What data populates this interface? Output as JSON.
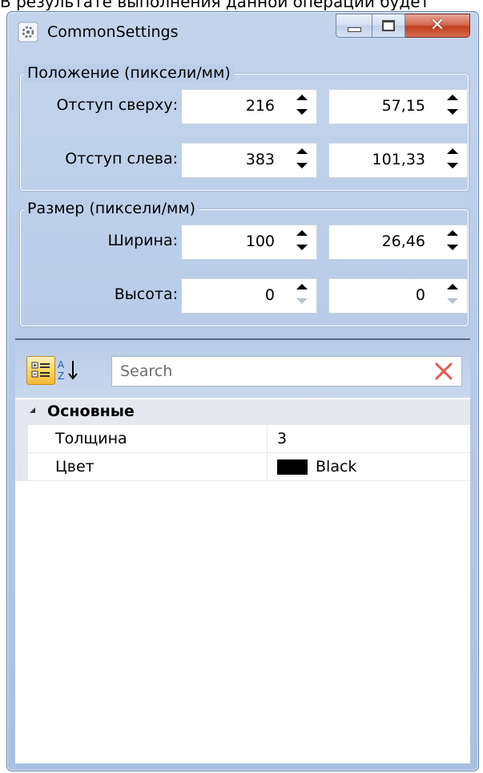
{
  "document_text": "В результате выполнения данной операции будет",
  "window": {
    "title": "CommonSettings",
    "close_glyph": "✕"
  },
  "position_group": {
    "title": "Положение (пиксели/мм)",
    "rows": [
      {
        "label": "Отступ сверху:",
        "pixels": "216",
        "mm": "57,15"
      },
      {
        "label": "Отступ слева:",
        "pixels": "383",
        "mm": "101,33"
      }
    ]
  },
  "size_group": {
    "title": "Размер (пиксели/мм)",
    "rows": [
      {
        "label": "Ширина:",
        "pixels": "100",
        "mm": "26,46"
      },
      {
        "label": "Высота:",
        "pixels": "0",
        "mm": "0"
      }
    ]
  },
  "property_grid": {
    "search": {
      "placeholder": "Search",
      "value": ""
    },
    "alpha_glyph": "↓",
    "category": "Основные",
    "properties": [
      {
        "name": "Толщина",
        "value": "3"
      },
      {
        "name": "Цвет",
        "value": "Black",
        "color": "#000000"
      }
    ]
  },
  "colors": {
    "window_bg": "#bccfea",
    "close_button": "#c2401f"
  },
  "icons": {
    "app": "settings-gear-icon",
    "minimize": "minimize-icon",
    "maximize": "maximize-icon",
    "close": "close-icon",
    "categorized": "categorized-view-icon",
    "alphabetical": "sort-az-icon",
    "clear": "clear-search-icon",
    "expand": "expand-triangle-icon"
  }
}
